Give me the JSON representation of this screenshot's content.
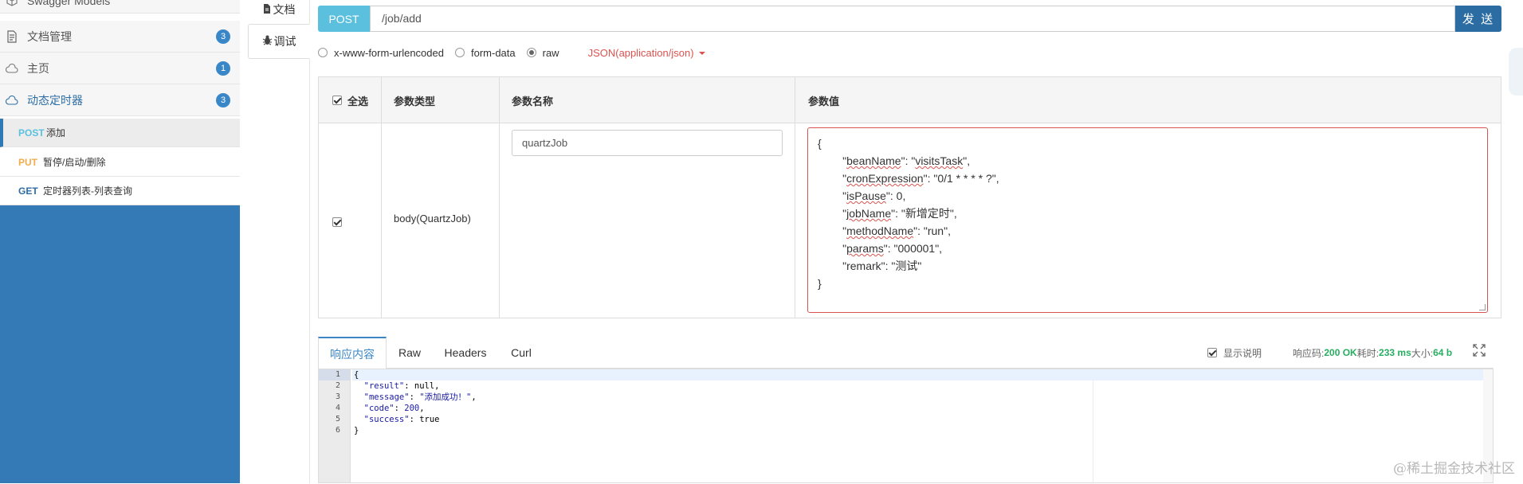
{
  "sidebar": {
    "top_item": "Swagger Models",
    "groups": [
      {
        "label": "文档管理",
        "count": "3"
      },
      {
        "label": "主页",
        "count": "1"
      },
      {
        "label": "动态定时器",
        "count": "3"
      }
    ],
    "endpoints": [
      {
        "method": "POST",
        "label": "添加",
        "color": "#5bc0de"
      },
      {
        "method": "PUT",
        "label": "暂停/启动/删除",
        "color": "#f0ad4e"
      },
      {
        "method": "GET",
        "label": "定时器列表-列表查询",
        "color": "#2c6ea6"
      }
    ]
  },
  "vtabs": {
    "doc": "文档",
    "debug": "调试"
  },
  "request": {
    "method": "POST",
    "url": "/job/add",
    "send": "发 送"
  },
  "body_types": {
    "options": [
      "x-www-form-urlencoded",
      "form-data",
      "raw"
    ],
    "selected": "raw",
    "content_type": "JSON(application/json)"
  },
  "params": {
    "headers": {
      "select_all": "全选",
      "type": "参数类型",
      "name": "参数名称",
      "value": "参数值"
    },
    "row": {
      "type": "body(QuartzJob)",
      "name": "quartzJob",
      "json_lines": [
        "{",
        "        \"beanName\": \"visitsTask\",",
        "        \"cronExpression\": \"0/1 * * * * ?\",",
        "        \"isPause\": 0,",
        "        \"jobName\": \"新增定时\",",
        "        \"methodName\": \"run\",",
        "        \"params\": \"000001\",",
        "        \"remark\": \"测试\"",
        "}"
      ]
    }
  },
  "response": {
    "tabs": [
      "响应内容",
      "Raw",
      "Headers",
      "Curl"
    ],
    "show_desc": "显示说明",
    "status_label": "响应码:",
    "status_value": "200 OK",
    "time_label": "耗时:",
    "time_value": "233 ms",
    "size_label": "大小:",
    "size_value": "64 b",
    "code_lines": [
      "{",
      "  \"result\": null,",
      "  \"message\": \"添加成功！\",",
      "  \"code\": 200,",
      "  \"success\": true",
      "}"
    ],
    "line_numbers": [
      "1",
      "2",
      "3",
      "4",
      "5",
      "6"
    ]
  },
  "watermark": "@稀土掘金技术社区"
}
